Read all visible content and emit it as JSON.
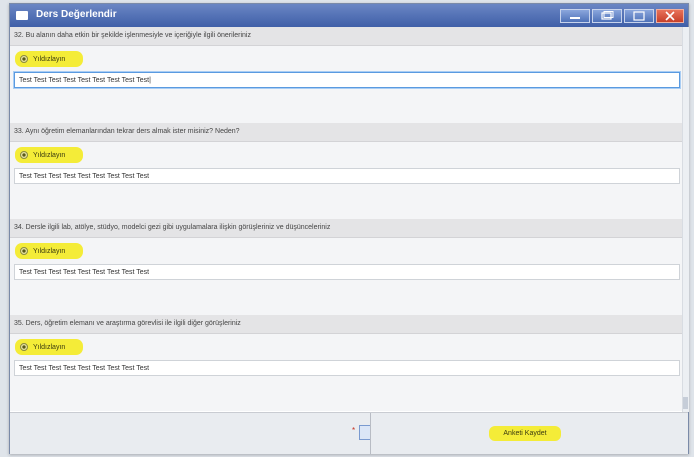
{
  "window": {
    "title": "Ders Değerlendir",
    "controls": [
      "minimize-icon",
      "restore-icon",
      "maximize-icon",
      "close-icon"
    ]
  },
  "questions": [
    {
      "text": "32. Bu alanın daha etkin bir şekilde işlenmesiyle ve içeriğiyle ilgili önerileriniz",
      "option_label": "Yıldızlayın",
      "answer": "Test Test Test Test Test Test Test Test Test|"
    },
    {
      "text": "33. Aynı öğretim elemanlarından tekrar ders almak ister misiniz? Neden?",
      "option_label": "Yıldızlayın",
      "answer": "Test Test Test Test Test Test Test Test Test"
    },
    {
      "text": "34. Dersle ilgili lab, atölye, stüdyo, modelci gezi gibi uygulamalara ilişkin görüşleriniz ve düşünceleriniz",
      "option_label": "Yıldızlayın",
      "answer": "Test Test Test Test Test Test Test Test Test"
    },
    {
      "text": "35. Ders, öğretim elemanı ve araştırma görevlisi ile ilgili diğer görüşleriniz",
      "option_label": "Yıldızlayın",
      "answer": "Test Test Test Test Test Test Test Test Test"
    }
  ],
  "footer": {
    "required_mark": "*",
    "save_label": "Anketi Kaydet"
  },
  "colors": {
    "titlebar": "#4f6fb8",
    "highlight": "#f4ec38",
    "close_button": "#d9533a"
  }
}
